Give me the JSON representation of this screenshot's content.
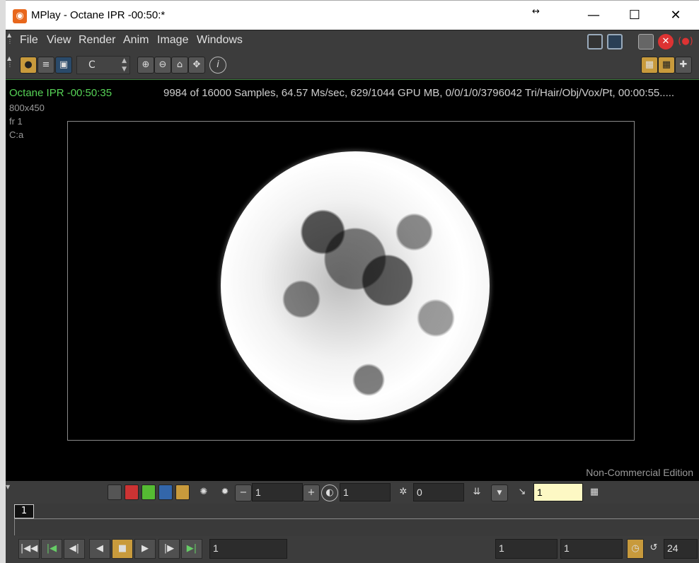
{
  "window": {
    "title": "MPlay - Octane IPR -00:50:*",
    "app_icon": "houdini-icon",
    "resize_glyph": "↔",
    "minimize": "—",
    "maximize": "☐",
    "close": "✕"
  },
  "menu": [
    "File",
    "View",
    "Render",
    "Anim",
    "Image",
    "Windows"
  ],
  "toolbar": {
    "channel_select": "C",
    "info_glyph": "i"
  },
  "viewport": {
    "render_title": "Octane IPR -00:50:35",
    "stats": "9984 of 16000 Samples, 64.57 Ms/sec, 629/1044 GPU MB, 0/0/1/0/3796042 Tri/Hair/Obj/Vox/Pt, 00:00:55.....",
    "resolution": "800x450",
    "frame": "fr 1",
    "channel": "C:a",
    "edition": "Non-Commercial Edition"
  },
  "display_controls": {
    "exposure_value": "1",
    "gamma_value": "1",
    "offset_value": "0",
    "lut_value": "1"
  },
  "timeline": {
    "current_frame_marker": "1"
  },
  "playback": {
    "frame_field": "1",
    "start_frame": "1",
    "end_frame": "1",
    "fps": "24"
  },
  "colors": {
    "accent": "#c89a3c",
    "render_title": "#56d256",
    "background": "#3c3c3c"
  }
}
